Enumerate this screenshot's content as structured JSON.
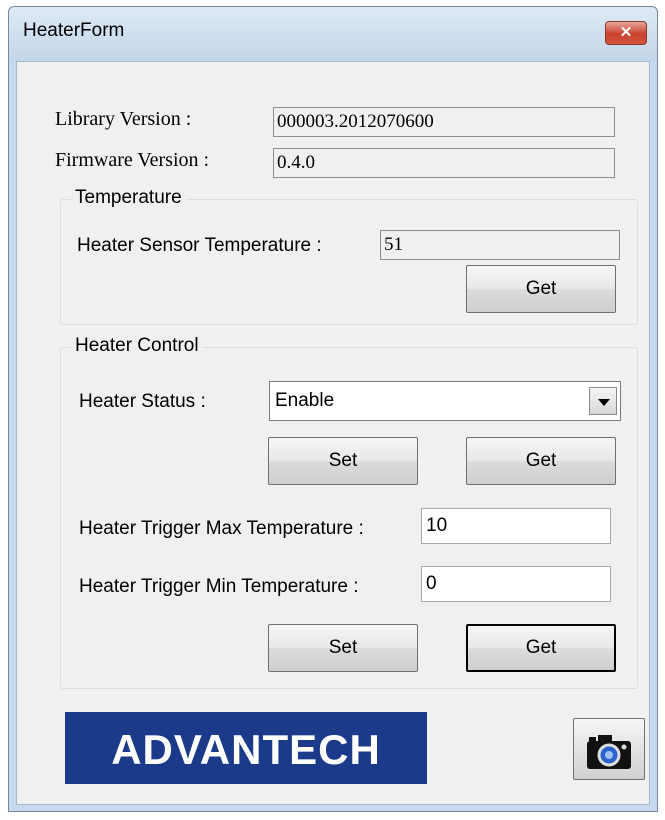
{
  "window": {
    "title": "HeaterForm",
    "close_glyph": "✕"
  },
  "info": {
    "library_label": "Library Version :",
    "library_value": "000003.2012070600",
    "firmware_label": "Firmware Version :",
    "firmware_value": "0.4.0"
  },
  "temperature": {
    "group_title": "Temperature",
    "sensor_label": "Heater Sensor Temperature :",
    "sensor_value": "51",
    "get_label": "Get"
  },
  "heater_control": {
    "group_title": "Heater Control",
    "status_label": "Heater Status :",
    "status_value": "Enable",
    "set_label": "Set",
    "get_label": "Get",
    "max_label": "Heater Trigger Max Temperature :",
    "max_value": "10",
    "min_label": "Heater Trigger Min Temperature :",
    "min_value": "0",
    "set2_label": "Set",
    "get2_label": "Get"
  },
  "footer": {
    "logo_text": "ADVANTECH",
    "camera_icon": "camera-icon"
  },
  "colors": {
    "logo_bg": "#1b3b8a",
    "close_red": "#c7432d"
  }
}
